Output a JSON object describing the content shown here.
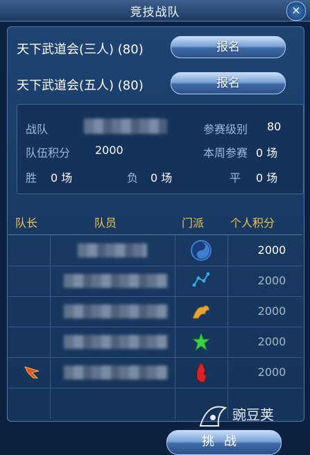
{
  "window": {
    "title": "竞技战队",
    "close_glyph": "×"
  },
  "registration": [
    {
      "label": "天下武道会(三人) (80)",
      "button": "报名"
    },
    {
      "label": "天下武道会(五人) (80)",
      "button": "报名"
    }
  ],
  "team_info": {
    "team_label": "战队",
    "level_label": "参赛级别",
    "level_value": "80",
    "score_label": "队伍积分",
    "score_value": "2000",
    "weekly_label": "本周参赛",
    "weekly_value": "0 场",
    "win_label": "胜",
    "win_value": "0 场",
    "lose_label": "负",
    "lose_value": "0 场",
    "draw_label": "平",
    "draw_value": "0 场"
  },
  "table": {
    "headers": [
      "队长",
      "队员",
      "门派",
      "个人积分"
    ],
    "rows": [
      {
        "score": "2000",
        "faction_icon": "taiji-icon",
        "captain": false,
        "faction_color": "#3f7fd0"
      },
      {
        "score": "2000",
        "faction_icon": "constellation-icon",
        "captain": false,
        "faction_color": "#3aa7e8"
      },
      {
        "score": "2000",
        "faction_icon": "golden-beast-icon",
        "captain": false,
        "faction_color": "#e0a63b"
      },
      {
        "score": "2000",
        "faction_icon": "green-star-icon",
        "captain": false,
        "faction_color": "#3ccf4a"
      },
      {
        "score": "2000",
        "faction_icon": "red-flame-icon",
        "captain": true,
        "faction_color": "#d3252a"
      }
    ]
  },
  "challenge_button": "挑战",
  "watermark": "豌豆荚",
  "colors": {
    "header_gold": "#f1c347",
    "panel_bg": "#1b3c69",
    "button_blue": "#7aa3d6"
  }
}
